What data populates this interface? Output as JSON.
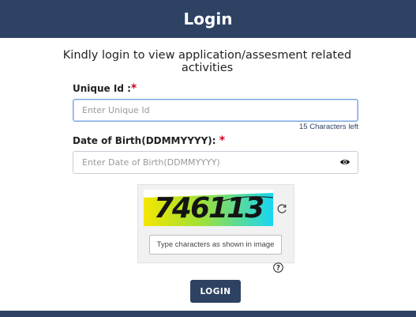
{
  "header": {
    "title": "Login"
  },
  "intro": {
    "text": "Kindly login to view application/assesment related activities"
  },
  "unique_id": {
    "label": "Unique Id :",
    "required_mark": "*",
    "placeholder": "Enter Unique Id",
    "value": "",
    "chars_left": "15 Characters left"
  },
  "dob": {
    "label": "Date of Birth(DDMMYYYY):",
    "required_mark": "*",
    "placeholder": "Enter Date of Birth(DDMMYYYY)",
    "value": "",
    "toggle_icon": "eye-icon"
  },
  "captcha": {
    "code": "746113",
    "refresh_icon": "refresh-icon",
    "placeholder": "Type characters as shown in image",
    "help_icon": "help-icon"
  },
  "login_button": {
    "label": "LOGIN"
  },
  "colors": {
    "primary": "#2e4363",
    "required": "#d0021b",
    "captcha_gradient_start": "#f2e600",
    "captcha_gradient_end": "#22d8f0"
  }
}
